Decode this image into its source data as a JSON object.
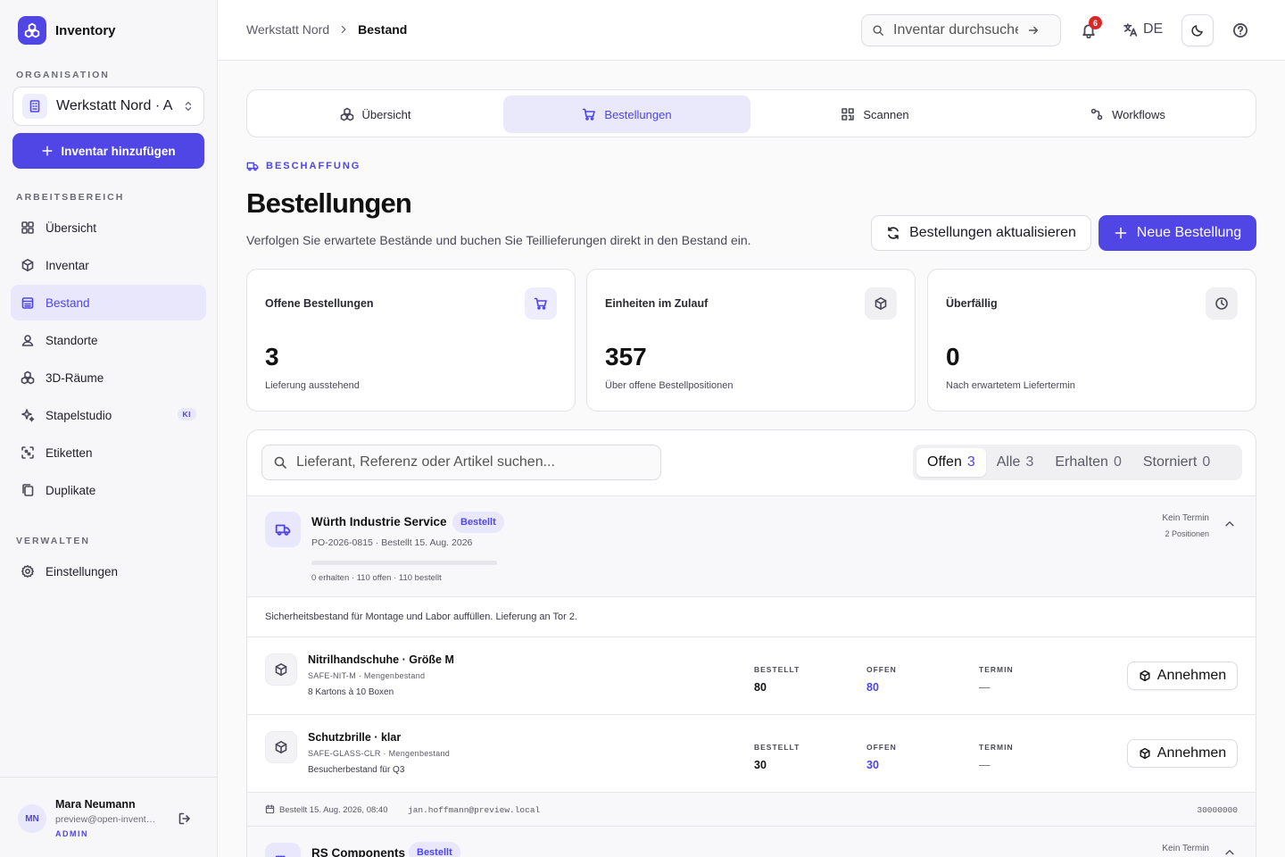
{
  "sidebar": {
    "brand": "Inventory",
    "org_label": "ORGANISATION",
    "org_name": "Werkstatt Nord · Admin",
    "add_button": "Inventar hinzufügen",
    "workspace_label": "ARBEITSBEREICH",
    "manage_label": "VERWALTEN",
    "items": [
      {
        "label": "Übersicht",
        "icon": "dashboard-icon"
      },
      {
        "label": "Inventar",
        "icon": "box-icon"
      },
      {
        "label": "Bestand",
        "icon": "stock-icon",
        "active": true
      },
      {
        "label": "Standorte",
        "icon": "location-icon"
      },
      {
        "label": "3D-Räume",
        "icon": "cubes-icon"
      },
      {
        "label": "Stapelstudio",
        "icon": "sparkle-icon",
        "badge": "KI"
      },
      {
        "label": "Etiketten",
        "icon": "scan-icon"
      },
      {
        "label": "Duplikate",
        "icon": "copy-icon"
      }
    ],
    "settings": "Einstellungen",
    "user": {
      "initials": "MN",
      "name": "Mara Neumann",
      "email": "preview@open-inventory.local",
      "role": "ADMIN"
    }
  },
  "header": {
    "breadcrumb": [
      "Werkstatt Nord",
      "Bestand"
    ],
    "search_placeholder": "Inventar durchsuchen",
    "notifications": "6",
    "language": "DE"
  },
  "tabs": [
    {
      "label": "Übersicht",
      "icon": "cubes-icon"
    },
    {
      "label": "Bestellungen",
      "icon": "cart-icon",
      "active": true
    },
    {
      "label": "Scannen",
      "icon": "qr-icon"
    },
    {
      "label": "Workflows",
      "icon": "workflow-icon"
    }
  ],
  "page": {
    "eyebrow": "BESCHAFFUNG",
    "title": "Bestellungen",
    "description": "Verfolgen Sie erwartete Bestände und buchen Sie Teillieferungen direkt in den Bestand ein.",
    "refresh_button": "Bestellungen aktualisieren",
    "new_button": "Neue Bestellung"
  },
  "stats": [
    {
      "label": "Offene Bestellungen",
      "value": "3",
      "sub": "Lieferung ausstehend",
      "icon": "cart-icon"
    },
    {
      "label": "Einheiten im Zulauf",
      "value": "357",
      "sub": "Über offene Bestellpositionen",
      "icon": "box-icon"
    },
    {
      "label": "Überfällig",
      "value": "0",
      "sub": "Nach erwartetem Liefertermin",
      "icon": "clock-icon"
    }
  ],
  "orders_panel": {
    "search_placeholder": "Lieferant, Referenz oder Artikel suchen...",
    "filters": [
      {
        "label": "Offen",
        "count": "3",
        "active": true
      },
      {
        "label": "Alle",
        "count": "3"
      },
      {
        "label": "Erhalten",
        "count": "0"
      },
      {
        "label": "Storniert",
        "count": "0"
      }
    ],
    "columns": {
      "ordered": "BESTELLT",
      "open": "OFFEN",
      "due": "TERMIN"
    },
    "accept_label": "Annehmen",
    "orders": [
      {
        "supplier": "Würth Industrie Service",
        "status": "Bestellt",
        "meta": "PO-2026-0815 · Bestellt 15. Aug. 2026",
        "progress": 0,
        "progress_text": "0 erhalten · 110 offen · 110 bestellt",
        "due": "Kein Termin",
        "positions": "2 Positionen",
        "note": "Sicherheitsbestand für Montage und Labor auffüllen. Lieferung an Tor 2.",
        "lines": [
          {
            "name": "Nitrilhandschuhe · Größe M",
            "sku": "SAFE-NIT-M · Mengenbestand",
            "note": "8 Kartons à 10 Boxen",
            "ordered": "80",
            "open": "80",
            "due": "—"
          },
          {
            "name": "Schutzbrille · klar",
            "sku": "SAFE-GLASS-CLR · Mengenbestand",
            "note": "Besucherbestand für Q3",
            "ordered": "30",
            "open": "30",
            "due": "—"
          }
        ],
        "footer_date": "Bestellt 15. Aug. 2026, 08:40",
        "footer_user": "jan.hoffmann@preview.local",
        "footer_number": "30000000"
      },
      {
        "supplier": "RS Components",
        "status": "Bestellt",
        "due": "Kein Termin"
      }
    ]
  }
}
